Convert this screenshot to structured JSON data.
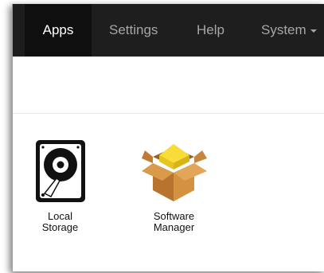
{
  "nav": {
    "items": [
      {
        "label": "Apps",
        "active": true
      },
      {
        "label": "Settings",
        "active": false
      },
      {
        "label": "Help",
        "active": false
      },
      {
        "label": "System",
        "active": false
      }
    ]
  },
  "apps": [
    {
      "label": "Local\nStorage",
      "icon": "hard-drive-icon"
    },
    {
      "label": "Software\nManager",
      "icon": "package-box-icon"
    }
  ],
  "colors": {
    "navbar": "#1e1e1e",
    "nav_active": "#0f0f0f",
    "nav_text": "#a6a6a6",
    "nav_active_text": "#ffffff",
    "box_brown": "#c9823c",
    "box_yellow": "#f2d22a"
  }
}
